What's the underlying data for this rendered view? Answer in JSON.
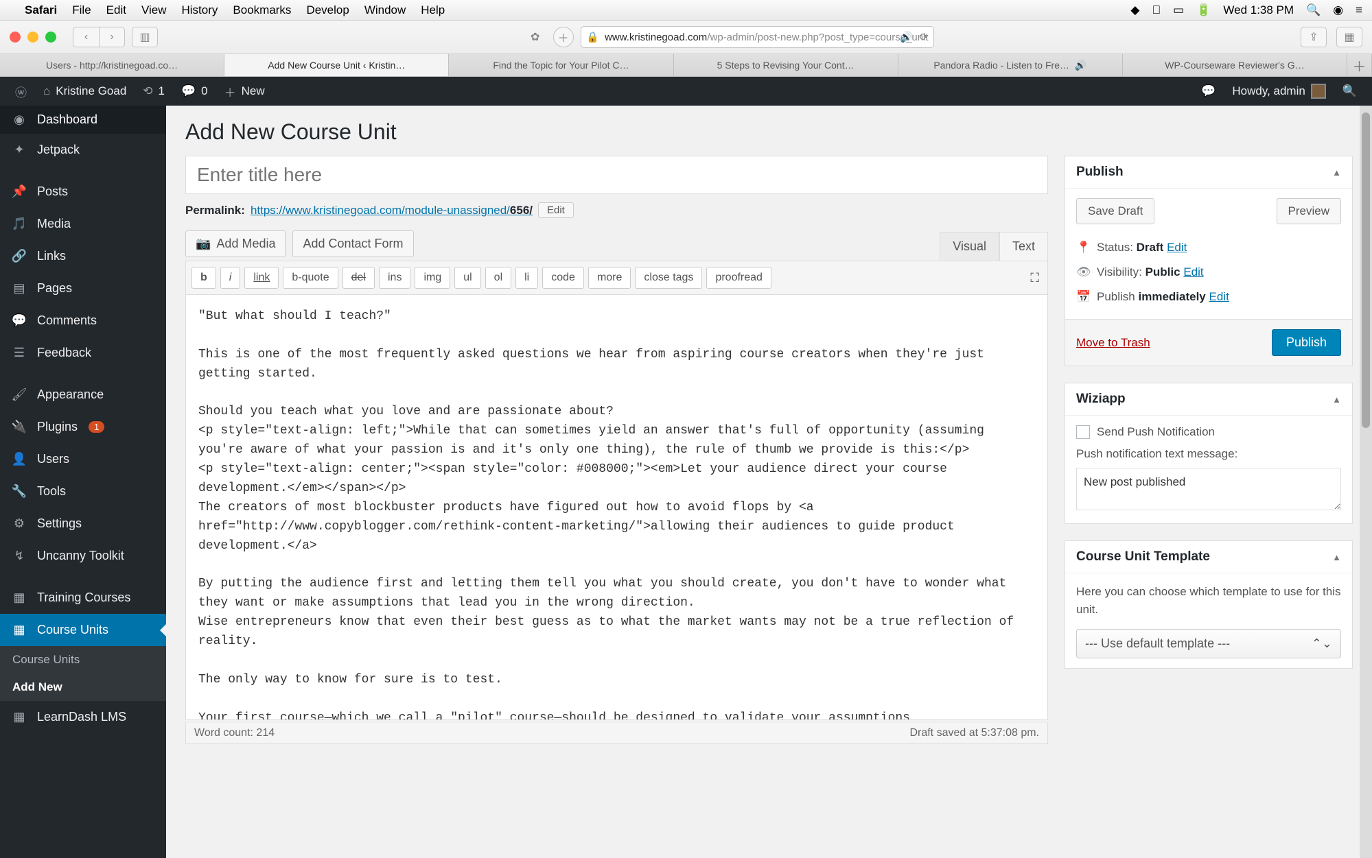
{
  "mac": {
    "app": "Safari",
    "menus": [
      "File",
      "Edit",
      "View",
      "History",
      "Bookmarks",
      "Develop",
      "Window",
      "Help"
    ],
    "clock": "Wed 1:38 PM"
  },
  "safari": {
    "url_domain": "www.kristinegoad.com",
    "url_path": "/wp-admin/post-new.php?post_type=course_unit",
    "tabs": [
      "Users - http://kristinegoad.co…",
      "Add New Course Unit ‹ Kristin…",
      "Find the Topic for Your Pilot C…",
      "5 Steps to Revising Your Cont…",
      "Pandora Radio - Listen to Fre…",
      "WP-Courseware Reviewer's G…"
    ],
    "active_tab": 1,
    "audio_tab": 4
  },
  "wp_bar": {
    "site": "Kristine Goad",
    "updates": "1",
    "comments": "0",
    "new": "New",
    "greeting": "Howdy, admin"
  },
  "sidebar": {
    "items": [
      {
        "icon": "◉",
        "label": "Dashboard"
      },
      {
        "icon": "✦",
        "label": "Jetpack"
      },
      {
        "icon": "📌",
        "label": "Posts",
        "sep": true
      },
      {
        "icon": "🎵",
        "label": "Media"
      },
      {
        "icon": "🔗",
        "label": "Links"
      },
      {
        "icon": "▤",
        "label": "Pages"
      },
      {
        "icon": "💬",
        "label": "Comments"
      },
      {
        "icon": "☰",
        "label": "Feedback"
      },
      {
        "icon": "🖌",
        "label": "Appearance",
        "sep": true
      },
      {
        "icon": "🔌",
        "label": "Plugins",
        "badge": "1"
      },
      {
        "icon": "👤",
        "label": "Users"
      },
      {
        "icon": "🔧",
        "label": "Tools"
      },
      {
        "icon": "⚙",
        "label": "Settings"
      },
      {
        "icon": "↯",
        "label": "Uncanny Toolkit"
      },
      {
        "icon": "▦",
        "label": "Training Courses",
        "sep": true
      },
      {
        "icon": "▦",
        "label": "Course Units",
        "active": true
      },
      {
        "icon": "▦",
        "label": "LearnDash LMS"
      }
    ],
    "subs": [
      "Course Units",
      "Add New"
    ],
    "sub_active": 1
  },
  "page": {
    "heading": "Add New Course Unit",
    "title_placeholder": "Enter title here",
    "permalink_label": "Permalink:",
    "permalink_base": "https://www.kristinegoad.com/module-unassigned/",
    "permalink_slug": "656/",
    "edit": "Edit",
    "add_media": "Add Media",
    "add_contact": "Add Contact Form",
    "tabs": {
      "visual": "Visual",
      "text": "Text"
    },
    "quicktags": [
      "b",
      "i",
      "link",
      "b-quote",
      "del",
      "ins",
      "img",
      "ul",
      "ol",
      "li",
      "code",
      "more",
      "close tags",
      "proofread"
    ],
    "content": "\"But what should I teach?\"\n\nThis is one of the most frequently asked questions we hear from aspiring course creators when they're just getting started.\n\nShould you teach what you love and are passionate about?\n<p style=\"text-align: left;\">While that can sometimes yield an answer that's full of opportunity (assuming you're aware of what your passion is and it's only one thing), the rule of thumb we provide is this:</p>\n<p style=\"text-align: center;\"><span style=\"color: #008000;\"><em>Let your audience direct your course development.</em></span></p>\nThe creators of most blockbuster products have figured out how to avoid flops by <a href=\"http://www.copyblogger.com/rethink-content-marketing/\">allowing their audiences to guide product development.</a>\n\nBy putting the audience first and letting them tell you what you should create, you don't have to wonder what they want or make assumptions that lead you in the wrong direction.\nWise entrepreneurs know that even their best guess as to what the market wants may not be a true reflection of reality.\n\nThe only way to know for sure is to test.\n\nYour first course—which we call a \"pilot\" course—should be designed to validate your assumptions",
    "word_count_label": "Word count:",
    "word_count": "214",
    "draft_saved": "Draft saved at 5:37:08 pm."
  },
  "publish": {
    "title": "Publish",
    "save_draft": "Save Draft",
    "preview": "Preview",
    "status_label": "Status:",
    "status_value": "Draft",
    "visibility_label": "Visibility:",
    "visibility_value": "Public",
    "publish_label": "Publish",
    "publish_value": "immediately",
    "edit": "Edit",
    "trash": "Move to Trash",
    "button": "Publish"
  },
  "wiziapp": {
    "title": "Wiziapp",
    "checkbox": "Send Push Notification",
    "msg_label": "Push notification text message:",
    "msg_value": "New post published"
  },
  "template": {
    "title": "Course Unit Template",
    "desc": "Here you can choose which template to use for this unit.",
    "select": "--- Use default template ---"
  }
}
